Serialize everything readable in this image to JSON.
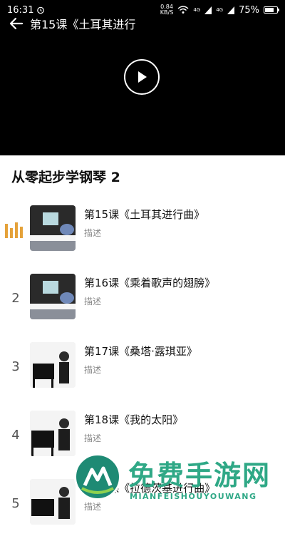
{
  "status": {
    "time": "16:31",
    "net_speed_value": "0.84",
    "net_speed_unit": "KB/S",
    "signal_label_1": "4G",
    "signal_label_2": "4G",
    "battery": "75%",
    "battery_level": 0.75
  },
  "video": {
    "title": "第15课《土耳其进行"
  },
  "course": {
    "title": "从零起步学钢琴 2"
  },
  "lessons": [
    {
      "index": "",
      "name": "第15课《土耳其进行曲》",
      "desc": "描述",
      "playing": true
    },
    {
      "index": "2",
      "name": "第16课《乘着歌声的翅膀》",
      "desc": "描述"
    },
    {
      "index": "3",
      "name": "第17课《桑塔·露琪亚》",
      "desc": "描述"
    },
    {
      "index": "4",
      "name": "第18课《我的太阳》",
      "desc": "描述"
    },
    {
      "index": "5",
      "name": "第19课《拉德茨基进行曲》",
      "desc": "描述"
    }
  ],
  "watermark": {
    "title": "免费手游网",
    "subtitle": "MIANFEISHOUYOUWANG"
  },
  "colors": {
    "accent_playing": "#e5a23a",
    "watermark": "#2fa886"
  }
}
